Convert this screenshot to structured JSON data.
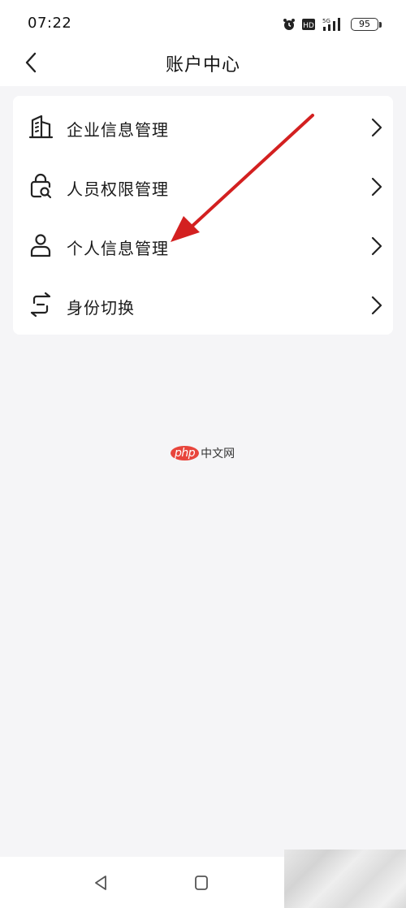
{
  "status_bar": {
    "time": "07:22",
    "battery": "95",
    "network": "5G",
    "icons": [
      "alarm-icon",
      "hd-icon",
      "signal-icon",
      "battery-icon"
    ]
  },
  "header": {
    "title": "账户中心",
    "back_icon": "chevron-left-icon"
  },
  "menu": {
    "items": [
      {
        "label": "企业信息管理",
        "icon": "building-icon"
      },
      {
        "label": "人员权限管理",
        "icon": "lock-search-icon"
      },
      {
        "label": "个人信息管理",
        "icon": "user-icon"
      },
      {
        "label": "身份切换",
        "icon": "switch-icon"
      }
    ]
  },
  "watermark": {
    "logo": "php",
    "text": "中文网"
  },
  "nav_bar": {
    "icons": [
      "nav-back-icon",
      "nav-home-icon"
    ]
  },
  "colors": {
    "background": "#f5f5f7",
    "card": "#ffffff",
    "annotation": "#d32020",
    "text": "#1a1a1a"
  }
}
